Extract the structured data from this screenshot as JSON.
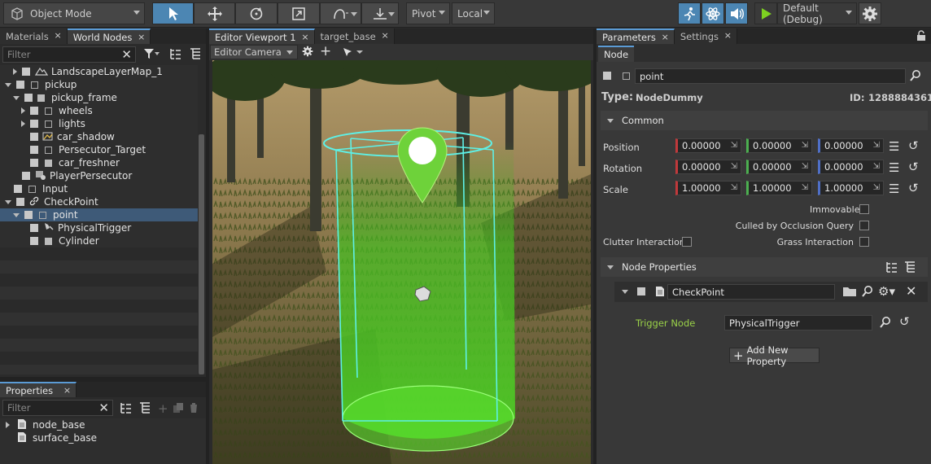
{
  "toolbar": {
    "mode": "Object Mode",
    "pivot": "Pivot",
    "space": "Local",
    "run_config": "Default (Debug)"
  },
  "left_panel": {
    "tabs": [
      {
        "label": "Materials"
      },
      {
        "label": "World Nodes"
      }
    ],
    "filter_placeholder": "Filter",
    "tree": [
      {
        "label": "LandscapeLayerMap_1"
      },
      {
        "label": "pickup"
      },
      {
        "label": "pickup_frame"
      },
      {
        "label": "wheels"
      },
      {
        "label": "lights"
      },
      {
        "label": "car_shadow"
      },
      {
        "label": "Persecutor_Target"
      },
      {
        "label": "car_freshner"
      },
      {
        "label": "PlayerPersecutor"
      },
      {
        "label": "Input"
      },
      {
        "label": "CheckPoint"
      },
      {
        "label": "point"
      },
      {
        "label": "PhysicalTrigger"
      },
      {
        "label": "Cylinder"
      }
    ]
  },
  "properties_panel": {
    "tab": "Properties",
    "filter_placeholder": "Filter",
    "items": [
      {
        "label": "node_base"
      },
      {
        "label": "surface_base"
      }
    ]
  },
  "viewport": {
    "tabs": [
      {
        "label": "Editor Viewport 1"
      },
      {
        "label": "target_base"
      }
    ],
    "camera": "Editor Camera"
  },
  "parameters": {
    "tabs": [
      {
        "label": "Parameters"
      },
      {
        "label": "Settings"
      }
    ],
    "subtab": "Node",
    "node_name": "point",
    "type_label": "Type:",
    "type_value": "NodeDummy",
    "id_label": "ID:",
    "id_value": "1288884361",
    "common_label": "Common",
    "position_label": "Position",
    "rotation_label": "Rotation",
    "scale_label": "Scale",
    "position": [
      "0.00000",
      "0.00000",
      "0.00000"
    ],
    "rotation": [
      "0.00000",
      "0.00000",
      "0.00000"
    ],
    "scale": [
      "1.00000",
      "1.00000",
      "1.00000"
    ],
    "immovable": "Immovable",
    "culled": "Culled by Occlusion Query",
    "clutter": "Clutter Interaction",
    "grass": "Grass Interaction",
    "node_properties": "Node Properties",
    "property_file": "CheckPoint",
    "trigger_label": "Trigger Node",
    "trigger_value": "PhysicalTrigger",
    "add_property": "Add New Property",
    "axis_colors": [
      "#c0393b",
      "#4caf50",
      "#4f6fc7"
    ]
  }
}
